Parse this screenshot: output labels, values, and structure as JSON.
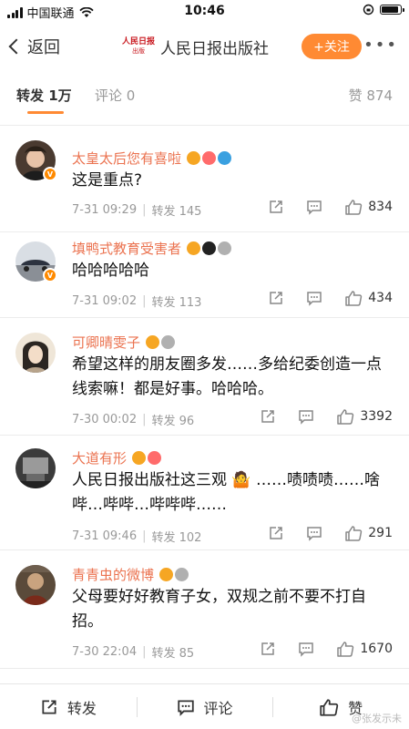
{
  "status_bar": {
    "carrier": "中国联通",
    "time": "10:46",
    "battery_level": 0.92
  },
  "nav": {
    "back_label": "返回",
    "account_name": "人民日报出版社",
    "logo_line1": "人民日报",
    "logo_line2": "出版",
    "follow_label": "+关注",
    "more_label": "•••"
  },
  "tabs": {
    "repost": "转发 1万",
    "comment": "评论 0",
    "like": "赞 874"
  },
  "reposts": [
    {
      "username": "太皇太后您有喜啦",
      "text": "这是重点?",
      "date": "7-31 09:29",
      "repost_label": "转发 145",
      "likes": "834",
      "badge_colors": [
        "#f6a623",
        "#ff6b6b",
        "#3aa0e0"
      ]
    },
    {
      "username": "填鸭式教育受害者",
      "text": "哈哈哈哈哈",
      "date": "7-31 09:02",
      "repost_label": "转发 113",
      "likes": "434",
      "badge_colors": [
        "#f6a623",
        "#222222",
        "#b0b0b0"
      ]
    },
    {
      "username": "可卿晴雯子",
      "text": "希望这样的朋友圈多发……多给纪委创造一点线索嘛！都是好事。哈哈哈。",
      "date": "7-30 00:02",
      "repost_label": "转发 96",
      "likes": "3392",
      "badge_colors": [
        "#f6a623",
        "#b0b0b0"
      ]
    },
    {
      "username": "大道有形",
      "text": "人民日报出版社这三观 🤷 ……啧啧啧……啥哔…哔哔…哔哔哔……",
      "date": "7-31 09:46",
      "repost_label": "转发 102",
      "likes": "291",
      "badge_colors": [
        "#f6a623",
        "#ff6b6b"
      ]
    },
    {
      "username": "青青虫的微博",
      "text": "父母要好好教育子女，双规之前不要不打自招。",
      "date": "7-30 22:04",
      "repost_label": "转发 85",
      "likes": "1670",
      "badge_colors": [
        "#f6a623",
        "#b0b0b0"
      ]
    }
  ],
  "bottom_bar": {
    "repost": "转发",
    "comment": "评论",
    "like": "赞"
  },
  "watermark": "@张发示未",
  "colors": {
    "accent": "#ff8a33",
    "username": "#eb7350",
    "verified": "#ff8a00"
  }
}
